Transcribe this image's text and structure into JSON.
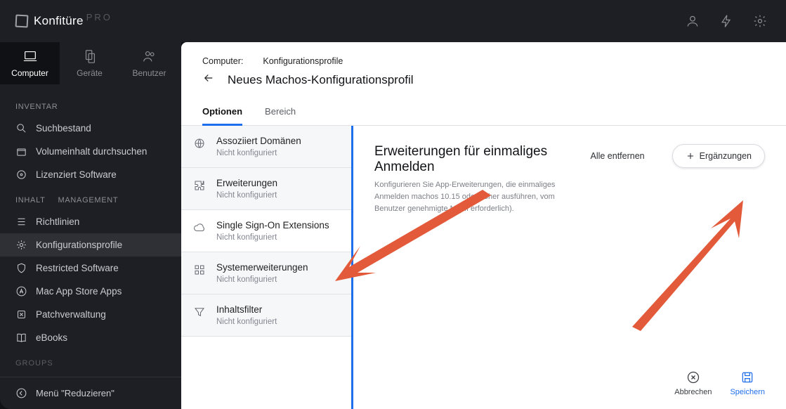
{
  "brand": {
    "name": "Konfitüre",
    "suffix": "PRO"
  },
  "topnav": {
    "account_icon": "user-icon",
    "bolt_icon": "bolt-icon",
    "settings_icon": "gear-icon"
  },
  "context_tabs": [
    {
      "key": "computer",
      "label": "Computer",
      "active": true
    },
    {
      "key": "devices",
      "label": "Geräte",
      "active": false
    },
    {
      "key": "users",
      "label": "Benutzer",
      "active": false
    }
  ],
  "sidebar": {
    "section_inventory": "INVENTAR",
    "items_inventory": [
      {
        "key": "search",
        "label": "Suchbestand"
      },
      {
        "key": "volumes",
        "label": "Volumeinhalt durchsuchen"
      },
      {
        "key": "licensed",
        "label": "Lizenziert   Software"
      }
    ],
    "section_content_left": "INHALT",
    "section_content_right": "MANAGEMENT",
    "items_content": [
      {
        "key": "policies",
        "label": "Richtlinien",
        "active": false
      },
      {
        "key": "profiles",
        "label": "Konfigurationsprofile",
        "active": true
      },
      {
        "key": "restricted",
        "label": "Restricted   Software",
        "active": false
      },
      {
        "key": "masapps",
        "label": "Mac App Store Apps",
        "active": false
      },
      {
        "key": "patch",
        "label": "Patchverwaltung",
        "active": false
      },
      {
        "key": "ebooks",
        "label": "eBooks",
        "active": false
      }
    ],
    "section_groups": "GROUPS",
    "collapse": "Menü \"Reduzieren\""
  },
  "crumb": {
    "c1": "Computer:",
    "c2": "Konfigurationsprofile"
  },
  "page_title": "Neues Machos-Konfigurationsprofil",
  "main_tabs": [
    {
      "key": "options",
      "label": "Optionen",
      "active": true
    },
    {
      "key": "scope",
      "label": "Bereich",
      "active": false
    }
  ],
  "cfg_items": [
    {
      "key": "assoc",
      "title": "Assoziiert   Domänen",
      "status": "Nicht konfiguriert",
      "icon": "globe-icon",
      "active": false
    },
    {
      "key": "ext",
      "title": "Erweiterungen",
      "status": "Nicht konfiguriert",
      "icon": "puzzle-icon",
      "active": false
    },
    {
      "key": "sso",
      "title": "Single Sign-On Extensions",
      "status": "Nicht konfiguriert",
      "icon": "cloud-icon",
      "active": true
    },
    {
      "key": "sysext",
      "title": "Systemerweiterungen",
      "status": "Nicht konfiguriert",
      "icon": "grid-icon",
      "active": false
    },
    {
      "key": "filter",
      "title": "Inhaltsfilter",
      "status": "Nicht konfiguriert",
      "icon": "funnel-icon",
      "active": false
    }
  ],
  "content": {
    "title": "Erweiterungen für einmaliges Anmelden",
    "subtitle": "Konfigurieren Sie App-Erweiterungen, die einmaliges Anmelden machos 10.15 oder höher ausführen, vom Benutzer genehmigte MDM erforderlich).",
    "remove_all": "Alle entfernen",
    "add": "Ergänzungen"
  },
  "footer": {
    "cancel": "Abbrechen",
    "save": "Speichern"
  }
}
